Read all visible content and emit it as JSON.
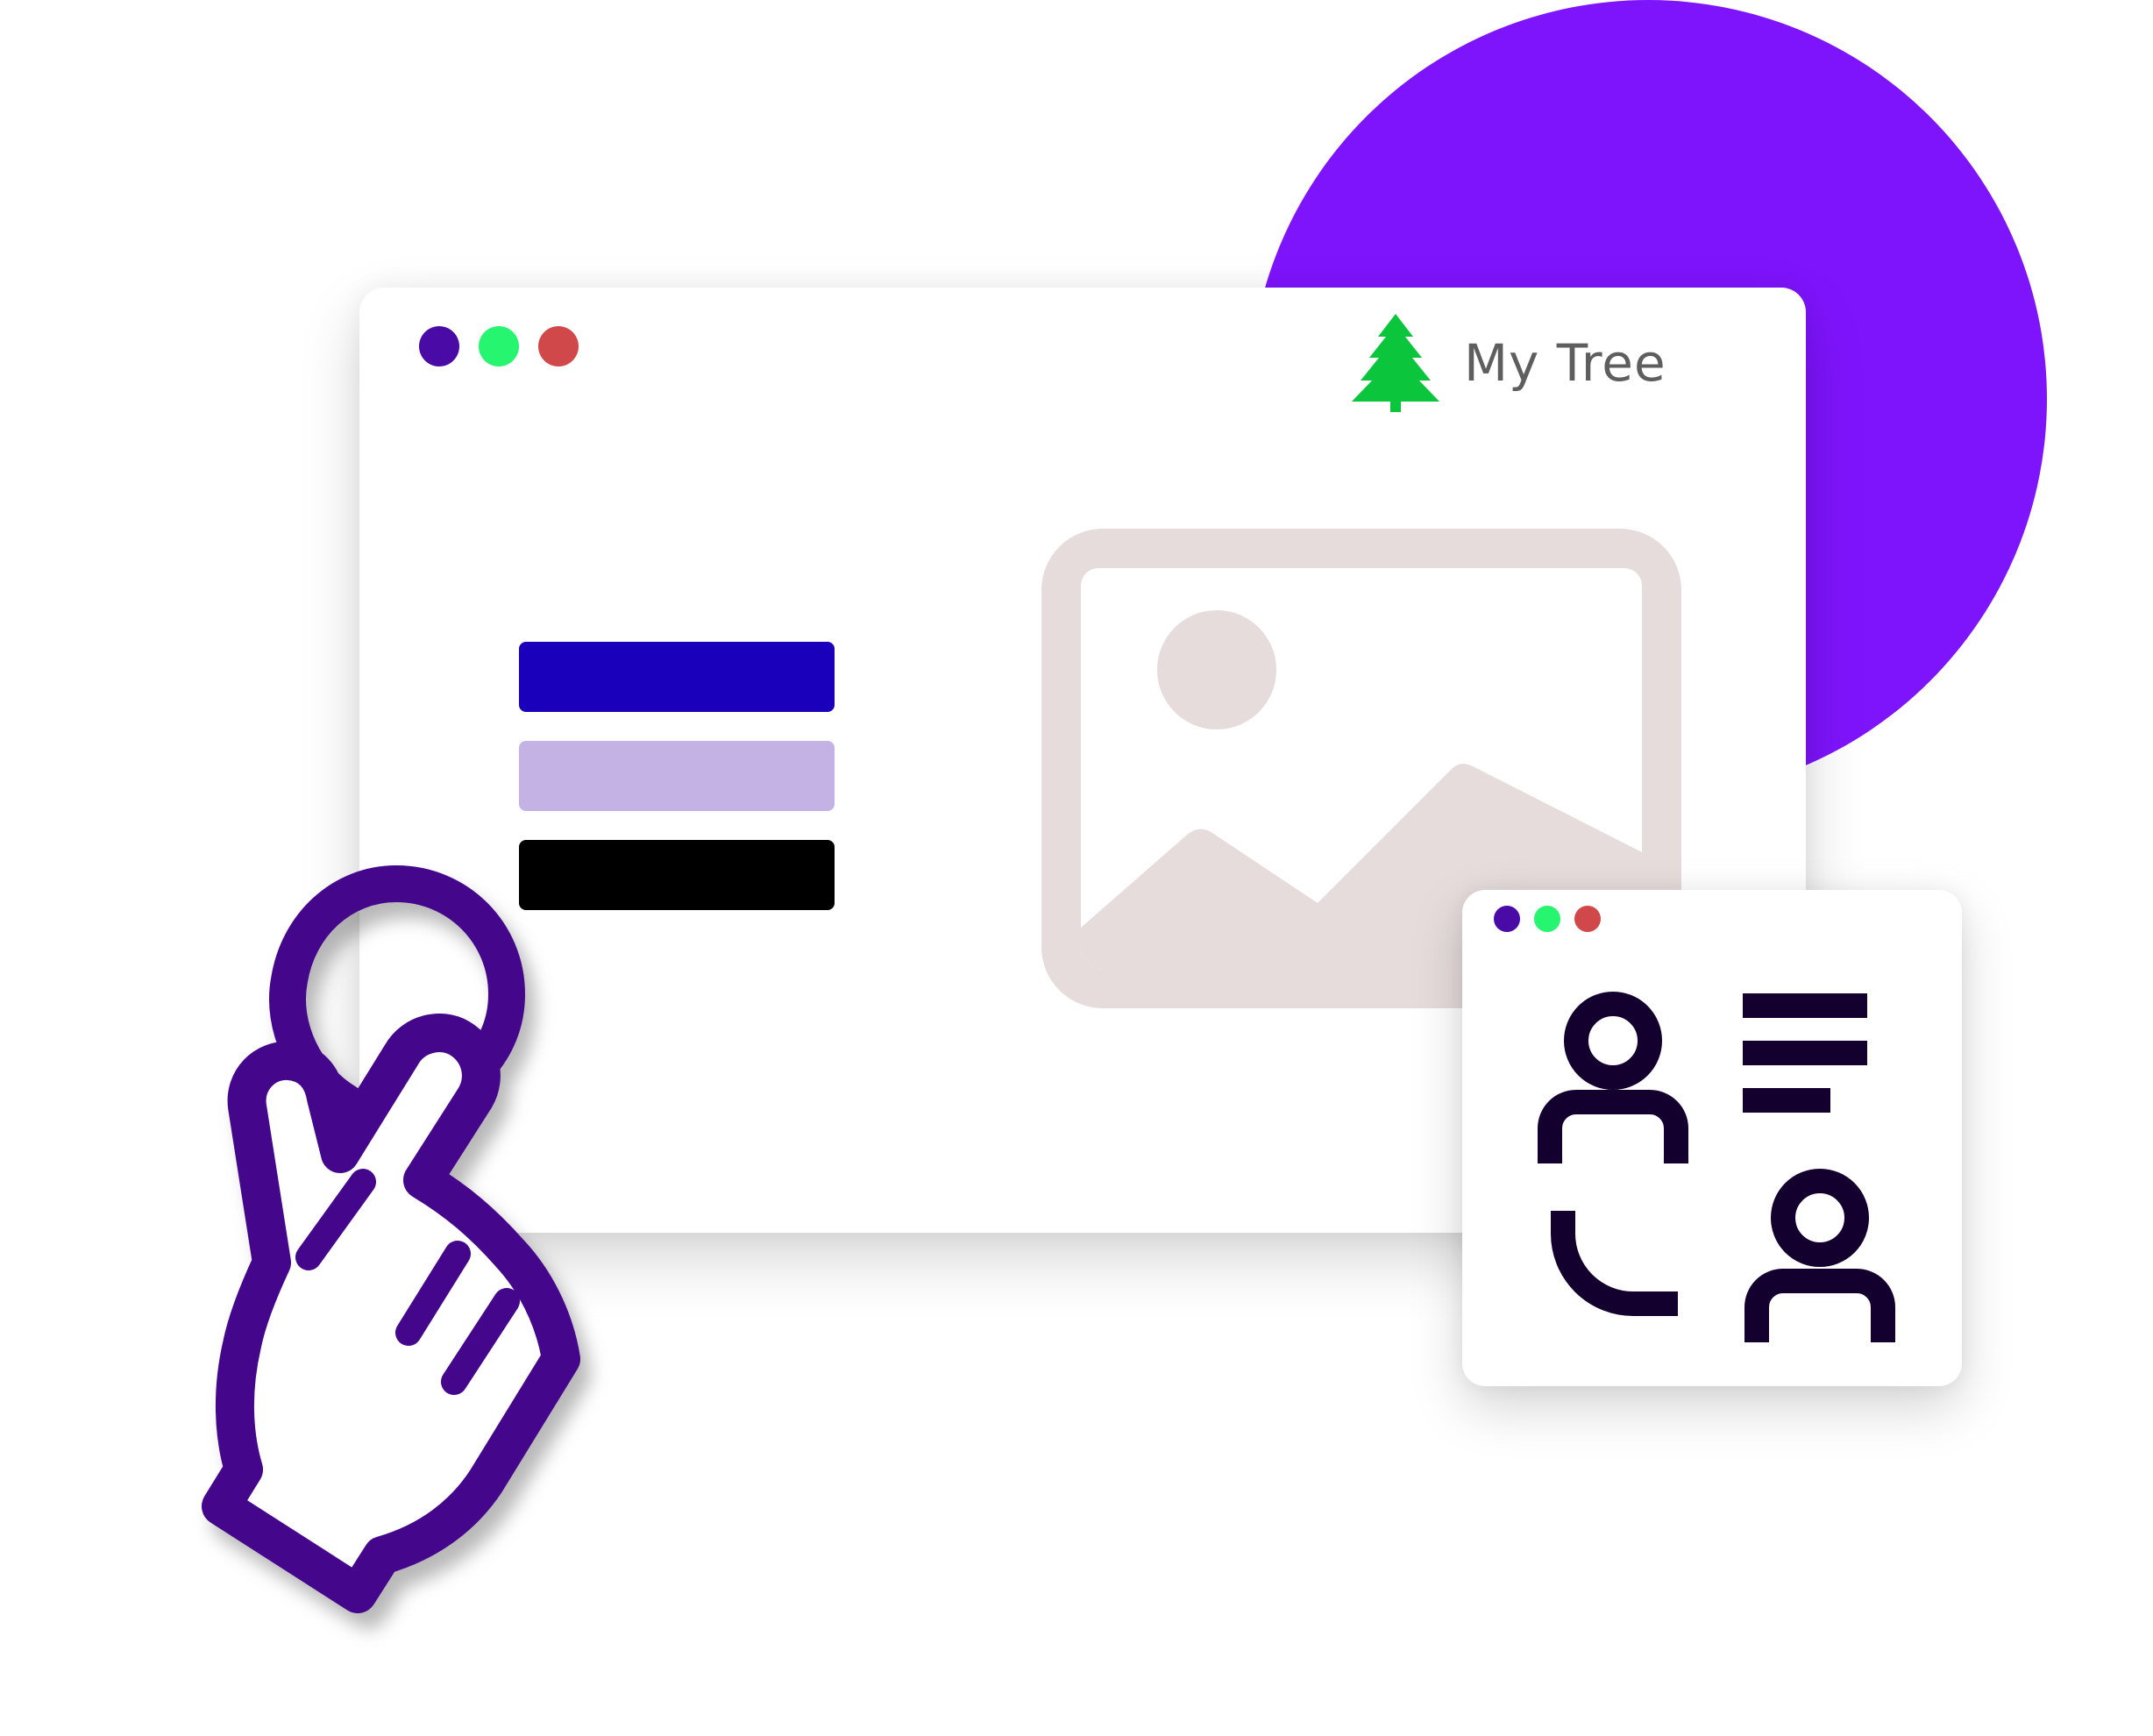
{
  "colors": {
    "accent_circle": "#7E14FC",
    "dot_purple": "#4A0AA6",
    "dot_green": "#26F570",
    "dot_red": "#D0484A",
    "bar_primary": "#1A00BA",
    "bar_secondary": "#C4B2E4",
    "bar_tertiary": "#000000",
    "image_placeholder": "#E5DCDB",
    "tree_green": "#0BC53C",
    "brand_text": "#5E5E5E",
    "profile_icon": "#14002E",
    "hand_outline": "#44078C",
    "hand_fill": "#FFFFFF"
  },
  "main_window": {
    "brand": {
      "name": "My Tree",
      "icon": "pine-tree-icon"
    },
    "window_controls": [
      "purple-dot",
      "green-dot",
      "red-dot"
    ],
    "menu_bars": [
      "primary-bar",
      "secondary-bar",
      "tertiary-bar"
    ],
    "image_icon": "image-placeholder-icon"
  },
  "profile_window": {
    "window_controls": [
      "purple-dot",
      "green-dot",
      "red-dot"
    ],
    "icons": [
      "user-icon",
      "text-lines-icon",
      "user-icon",
      "curve-connector-icon"
    ]
  },
  "pointer": {
    "icon": "pointing-hand-cursor-icon"
  }
}
